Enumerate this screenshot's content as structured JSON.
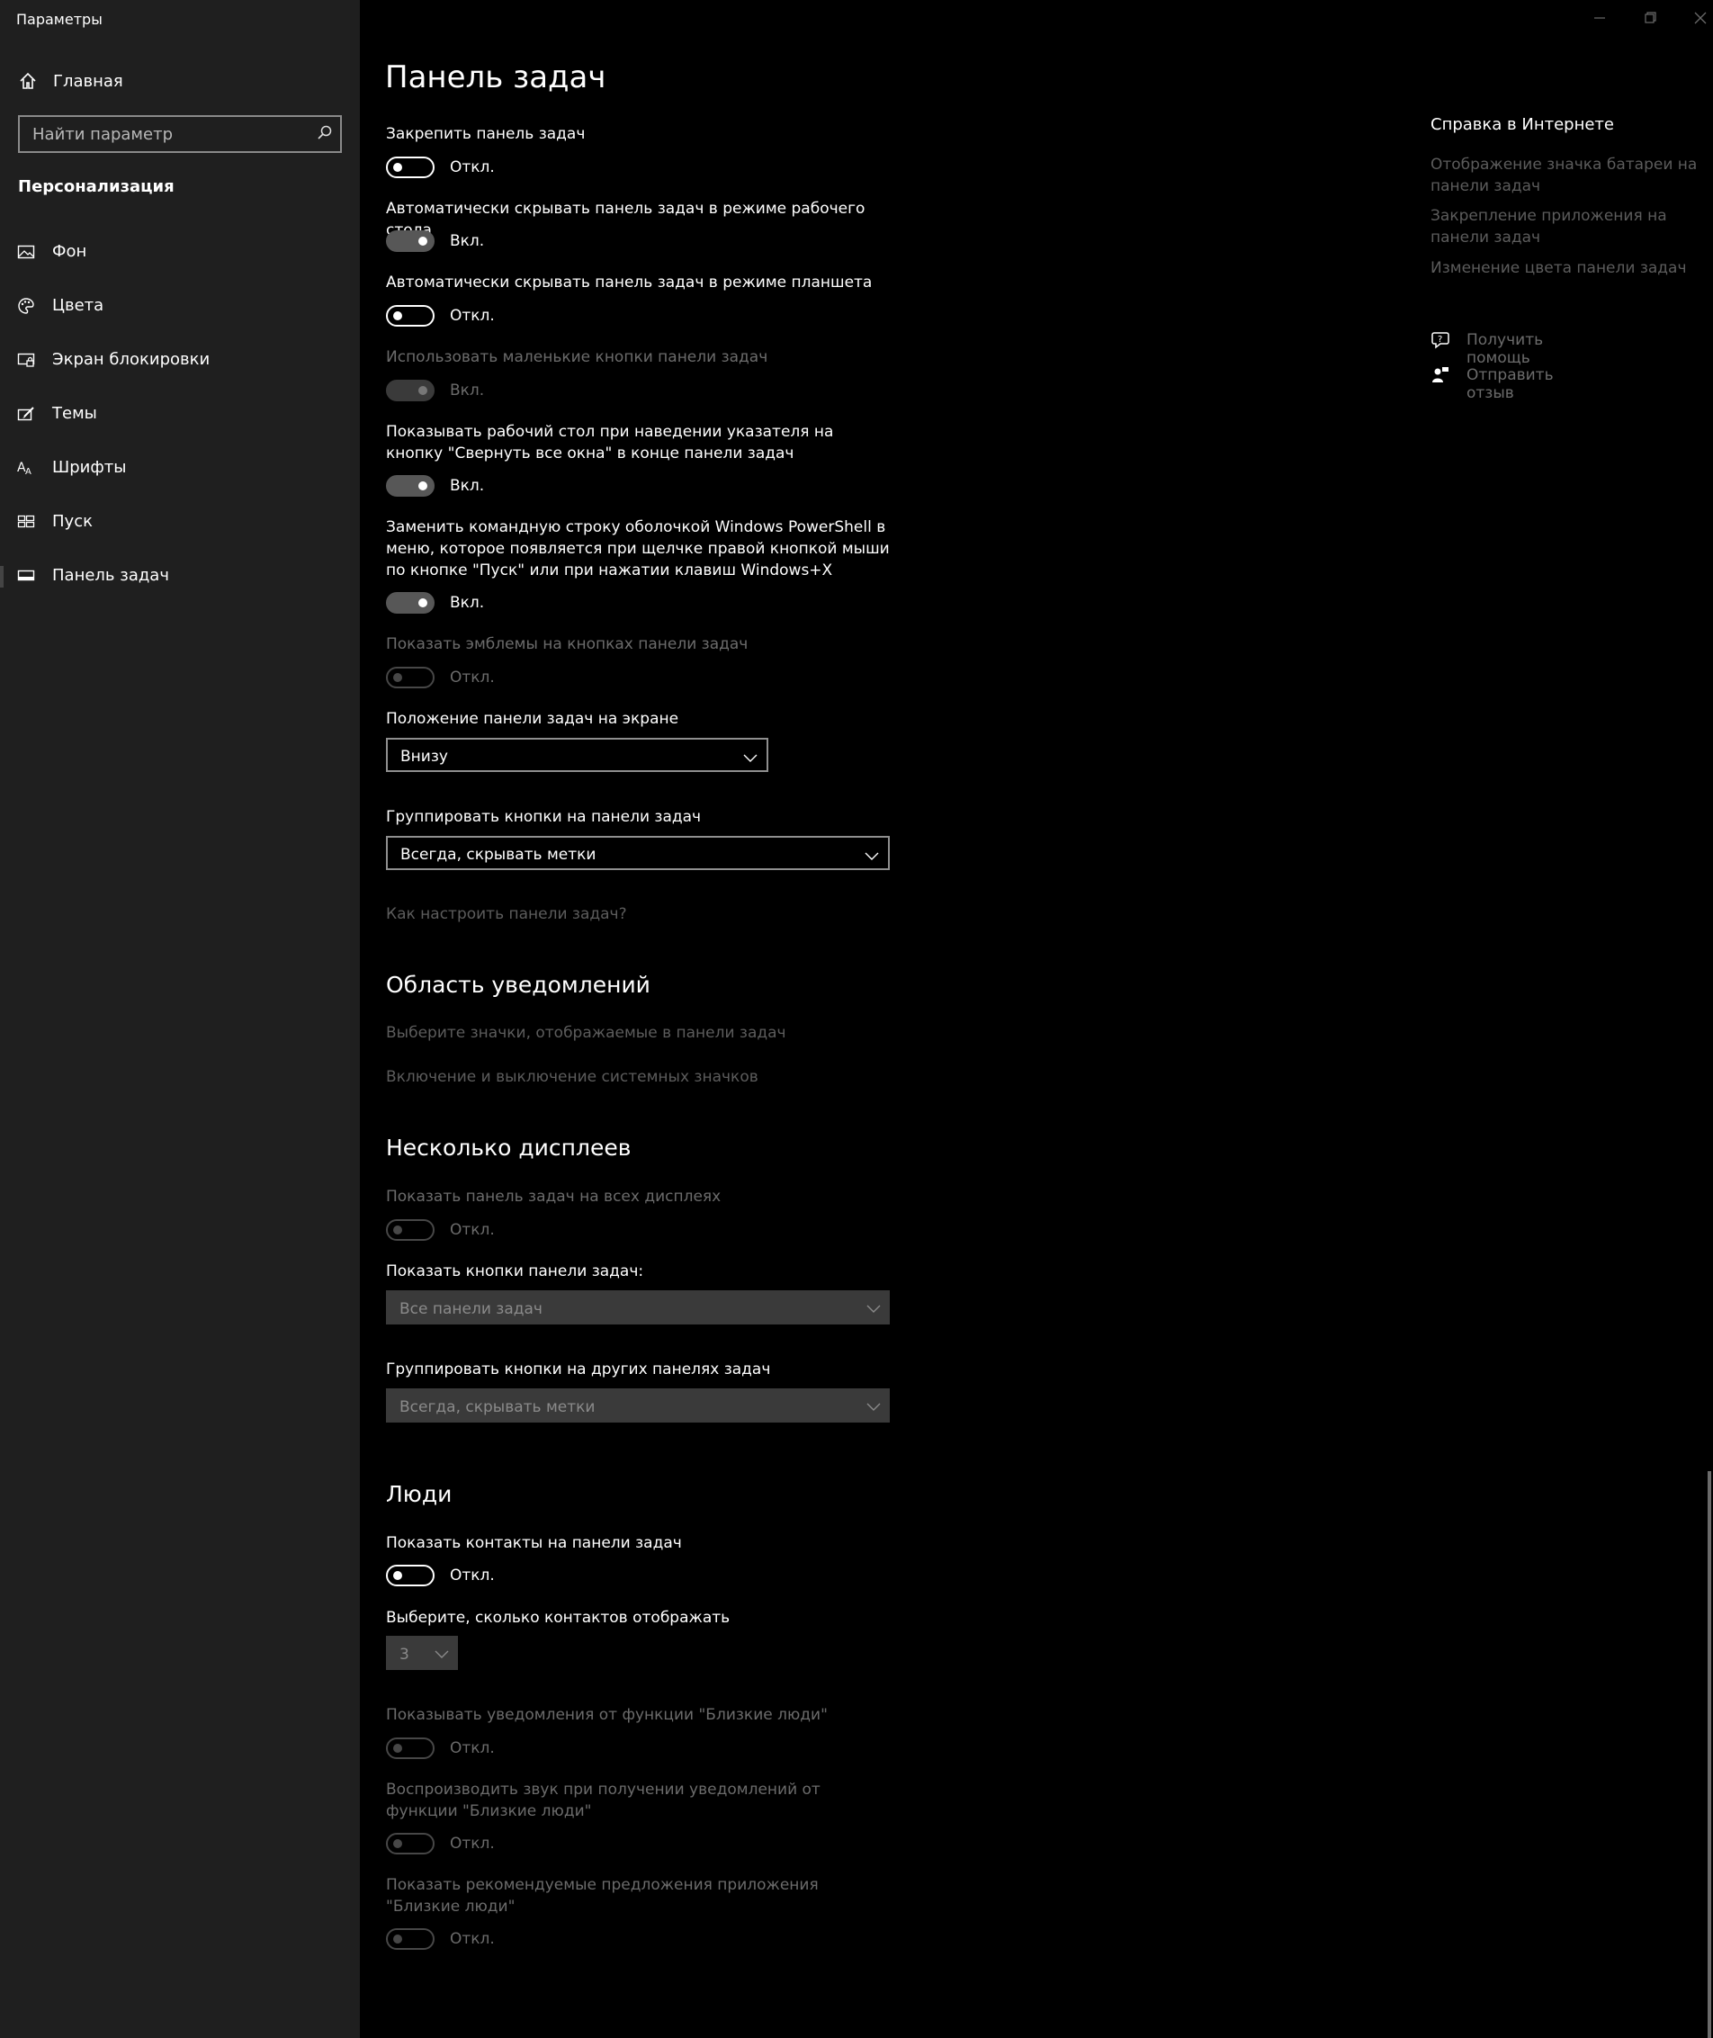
{
  "window": {
    "title": "Параметры",
    "controls": [
      "minimize-icon",
      "restore-icon",
      "close-icon"
    ]
  },
  "sidebar": {
    "home": {
      "label": "Главная",
      "icon": "home-icon"
    },
    "search": {
      "placeholder": "Найти параметр",
      "icon": "search-icon"
    },
    "section": "Персонализация",
    "items": [
      {
        "label": "Фон",
        "icon": "picture-icon"
      },
      {
        "label": "Цвета",
        "icon": "palette-icon"
      },
      {
        "label": "Экран блокировки",
        "icon": "lock-screen-icon"
      },
      {
        "label": "Темы",
        "icon": "brush-icon"
      },
      {
        "label": "Шрифты",
        "icon": "fonts-icon"
      },
      {
        "label": "Пуск",
        "icon": "start-icon"
      },
      {
        "label": "Панель задач",
        "icon": "taskbar-icon",
        "active": true
      }
    ]
  },
  "main": {
    "title": "Панель задач",
    "settings": [
      {
        "label": "Закрепить панель задач",
        "state": "Откл.",
        "on": false
      },
      {
        "label": "Автоматически скрывать панель задач в режиме рабочего стола",
        "state": "Вкл.",
        "on": true
      },
      {
        "label": "Автоматически скрывать панель задач в режиме планшета",
        "state": "Откл.",
        "on": false
      },
      {
        "label": "Использовать маленькие кнопки панели задач",
        "state": "Вкл.",
        "on": true,
        "disabled": true
      },
      {
        "label": "Показывать рабочий стол при наведении указателя на кнопку \"Свернуть все окна\" в конце панели задач",
        "state": "Вкл.",
        "on": true
      },
      {
        "label": "Заменить командную строку оболочкой Windows PowerShell в меню, которое появляется при щелчке правой кнопкой мыши по кнопке \"Пуск\" или при нажатии клавиш Windows+X",
        "state": "Вкл.",
        "on": true
      },
      {
        "label": "Показать эмблемы на кнопках панели задач",
        "state": "Откл.",
        "on": false,
        "disabled": true
      }
    ],
    "position": {
      "label": "Положение панели задач на экране",
      "value": "Внизу"
    },
    "grouping": {
      "label": "Группировать кнопки на панели задач",
      "value": "Всегда, скрывать метки"
    },
    "customize_link": "Как настроить панели задач?",
    "notifications": {
      "title": "Область уведомлений",
      "links": [
        "Выберите значки, отображаемые в панели задач",
        "Включение и выключение системных значков"
      ]
    },
    "multi_display": {
      "title": "Несколько дисплеев",
      "show_all": {
        "label": "Показать панель задач на всех дисплеях",
        "state": "Откл.",
        "on": false,
        "disabled": true
      },
      "show_buttons": {
        "label": "Показать кнопки панели задач:",
        "value": "Все панели задач"
      },
      "group_other": {
        "label": "Группировать кнопки на других панелях задач",
        "value": "Всегда, скрывать метки"
      }
    },
    "people": {
      "title": "Люди",
      "show_contacts": {
        "label": "Показать контакты на панели задач",
        "state": "Откл.",
        "on": false
      },
      "contacts_count": {
        "label": "Выберите, сколько контактов отображать",
        "value": "3"
      },
      "settings": [
        {
          "label": "Показывать уведомления от функции \"Близкие люди\"",
          "state": "Откл.",
          "on": false,
          "disabled": true
        },
        {
          "label": "Воспроизводить звук при получении уведомлений от функции \"Близкие люди\"",
          "state": "Откл.",
          "on": false,
          "disabled": true
        },
        {
          "label": "Показать рекомендуемые предложения приложения \"Близкие люди\"",
          "state": "Откл.",
          "on": false,
          "disabled": true
        }
      ]
    }
  },
  "help": {
    "title": "Справка в Интернете",
    "links": [
      "Отображение значка батареи на панели задач",
      "Закрепление приложения на панели задач",
      "Изменение цвета панели задач"
    ],
    "get_help": {
      "label": "Получить помощь",
      "icon": "chat-help-icon"
    },
    "feedback": {
      "label": "Отправить отзыв",
      "icon": "feedback-icon"
    }
  }
}
